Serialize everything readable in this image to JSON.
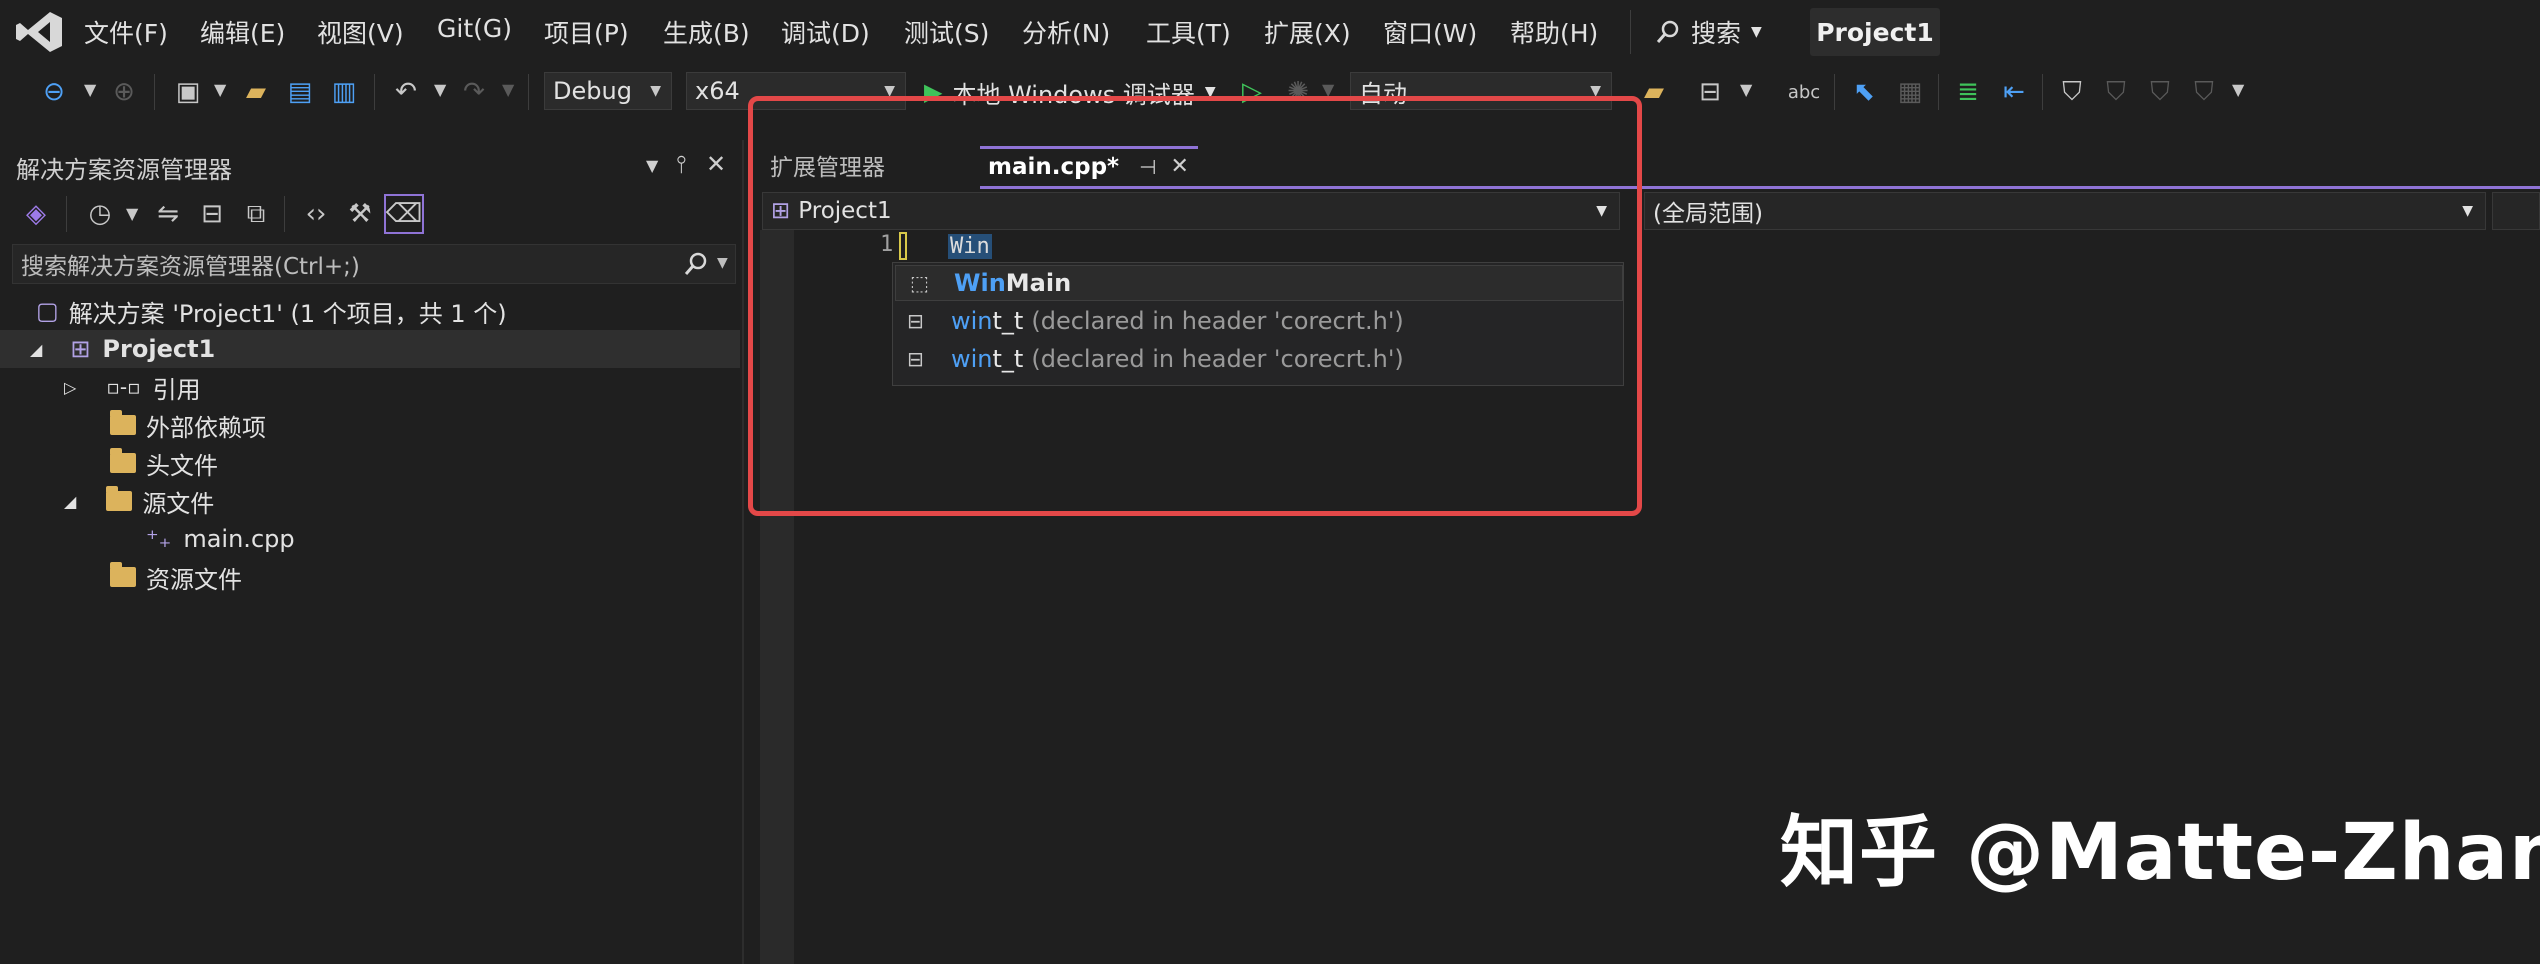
{
  "menu": {
    "items": [
      "文件(F)",
      "编辑(E)",
      "视图(V)",
      "Git(G)",
      "项目(P)",
      "生成(B)",
      "调试(D)",
      "测试(S)",
      "分析(N)",
      "工具(T)",
      "扩展(X)",
      "窗口(W)",
      "帮助(H)"
    ],
    "search_label": "搜索",
    "window_title": "Project1"
  },
  "toolbar": {
    "config": "Debug",
    "platform": "x64",
    "debugger_label": "本地 Windows 调试器",
    "auto_label": "自动"
  },
  "solution_explorer": {
    "title": "解决方案资源管理器",
    "search_placeholder": "搜索解决方案资源管理器(Ctrl+;)",
    "tree": {
      "solution": "解决方案 'Project1' (1 个项目，共 1 个)",
      "project": "Project1",
      "references": "引用",
      "external_deps": "外部依赖项",
      "header_files": "头文件",
      "source_files": "源文件",
      "main_cpp": "main.cpp",
      "resource_files": "资源文件"
    }
  },
  "editor": {
    "tabs": {
      "extensions": "扩展管理器",
      "main": "main.cpp*"
    },
    "nav_project": "Project1",
    "nav_scope": "(全局范围)",
    "line_number": "1",
    "code_text": "Win",
    "completion": [
      {
        "match": "Win",
        "rest": "Main",
        "desc": ""
      },
      {
        "match": "win",
        "rest": "t_t",
        "desc": "(declared in header 'corecrt.h')"
      },
      {
        "match": "win",
        "rest": "t_t",
        "desc": "(declared in header 'corecrt.h')"
      }
    ]
  },
  "watermark": "知乎 @Matte-Zhang",
  "colors": {
    "accent": "#8f73d6",
    "highlight": "#e34848",
    "match": "#4ea0f5"
  }
}
